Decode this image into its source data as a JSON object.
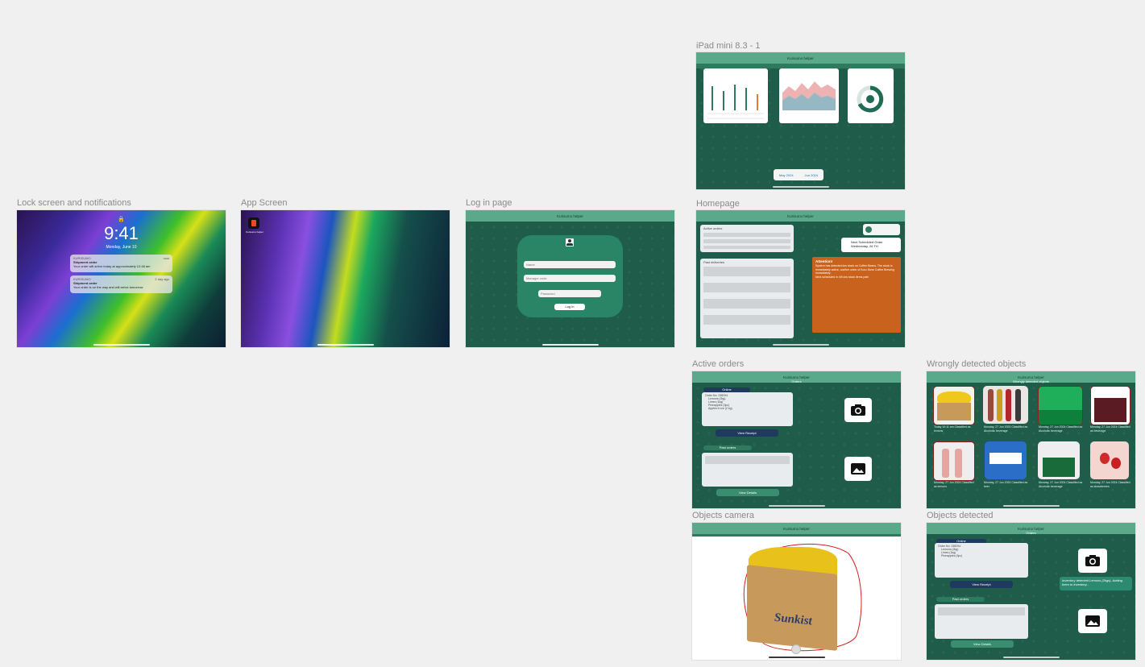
{
  "frames": {
    "ipad_mini": {
      "label": "iPad mini 8.3 - 1",
      "app_title": "Kurisumo helper",
      "date_chips": [
        "May 2024",
        "Jun 2024"
      ]
    },
    "lock": {
      "label": "Lock screen and notifications",
      "time": "9:41",
      "date": "Monday, June 10",
      "notifications": [
        {
          "app": "KURISUMO",
          "when": "now",
          "title": "Shipment order",
          "body": "Your order will arrive today at approximately 12:48 am"
        },
        {
          "app": "KURISUMO",
          "when": "2 day ago",
          "title": "Shipment order",
          "body": "Your order is on the way and will arrive tomorrow"
        }
      ]
    },
    "app_screen": {
      "label": "App Screen",
      "app_icon_label": "Kurisumo helper"
    },
    "login": {
      "label": "Log in page",
      "app_title": "Kurisumo helper",
      "name_placeholder": "Name",
      "manager_placeholder": "Manager code",
      "password_placeholder": "Password",
      "login_button": "Log in"
    },
    "homepage": {
      "label": "Homepage",
      "app_title": "Kurisumo helper",
      "active_orders_title": "Active orders",
      "past_deliveries_title": "Past deliveries",
      "next_delivery": "Next Scheduled Order Wednesday, 26 TH",
      "attention_title": "Attention!",
      "attention_items": [
        "System has detected low stock on Coffee Beans. The stock is immediately active, confirm order of Kuro Store Coffee Brewing immediately",
        "Next scheduled in 4th low stock items path"
      ]
    },
    "active_orders": {
      "label": "Active orders",
      "app_title": "Kurisumo helper",
      "page_title": "Orders",
      "tab_label": "Online",
      "order_lines": [
        "Order No: 238294",
        "Lemons (2kg)",
        "Limes (1kg)",
        "Pineapples (3pc)",
        "Apples in ice (2 kg)"
      ],
      "view_receipt": "View Receipt",
      "past_label": "Past orders",
      "view_details": "View Details"
    },
    "wrongly": {
      "label": "Wrongly detected objects",
      "app_title": "Kurisumo helper",
      "page_title": "Wrongly detected objects",
      "captions": [
        "Today 10:11 am Classified as lemons",
        "Monday, 27 Jun 2024 Classified as Alcoholic beverage",
        "Monday, 27 Jun 2024 Classified as Alcoholic beverage",
        "Monday, 27 Jun 2024 Classified as beverage",
        "Monday, 27 Jun 2024 Classified as lemons",
        "Monday, 27 Jun 2024 Classified as beer",
        "Monday, 27 Jun 2024 Classified as Alcoholic beverage",
        "Monday, 27 Jun 2024 Classified as strawberries"
      ]
    },
    "objects_camera": {
      "label": "Objects camera",
      "app_title": "Kurisumo helper",
      "box_brand": "Sunkist"
    },
    "objects_detected": {
      "label": "Objects detected",
      "app_title": "Kurisumo helper",
      "page_title": "Orders",
      "tab_label": "Online",
      "toast": "Inventory detected Lemons (2kgs). Adding them to inventory...",
      "view_receipt": "View Receipt",
      "past_label": "Past orders",
      "view_details": "View Details"
    }
  },
  "colors": {
    "canvas": "#f0f0f0",
    "app_green": "#1f5c4a",
    "topbar_green": "#5aa98a",
    "attention_orange": "#c8621c",
    "navy_button": "#1e3a5f"
  }
}
